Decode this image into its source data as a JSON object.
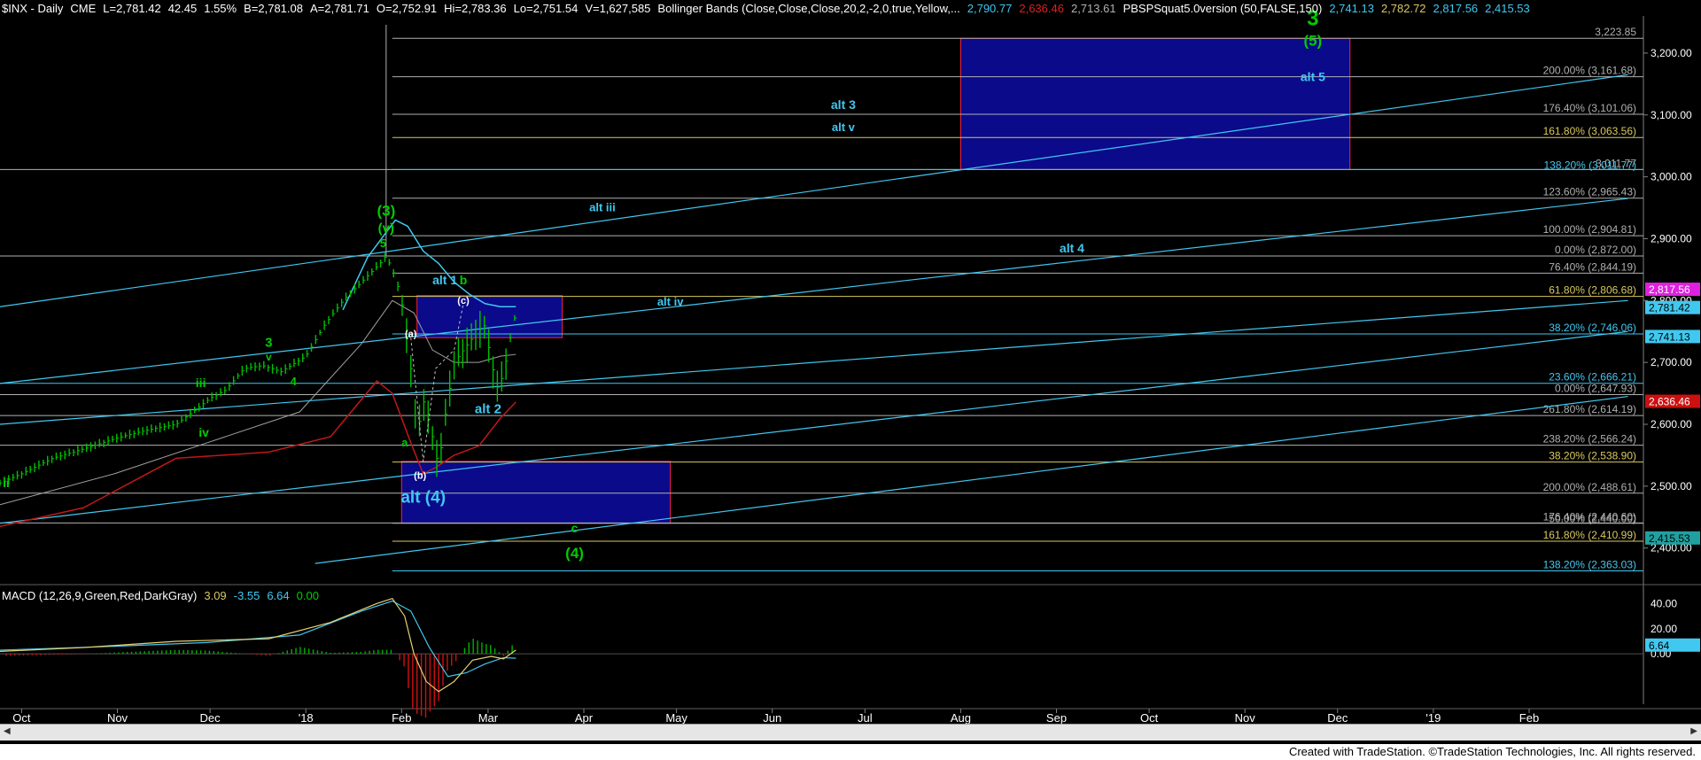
{
  "header": {
    "symbol": "$INX - Daily",
    "exchange": "CME",
    "last": "L=2,781.42",
    "chg": "42.45",
    "pct": "1.55%",
    "bid": "B=2,781.08",
    "ask": "A=2,781.71",
    "open": "O=2,752.91",
    "high": "Hi=2,783.36",
    "low": "Lo=2,751.54",
    "vol": "V=1,627,585",
    "bb": "Bollinger Bands (Close,Close,Close,20,2,-2,0,true,Yellow,...",
    "bb_v1": "2,790.77",
    "bb_v2": "2,636.46",
    "bb_v3": "2,713.61",
    "pbsp": "PBSPSquat5.0version (50,FALSE,150)",
    "pbsp_v1": "2,741.13",
    "pbsp_v2": "2,782.72",
    "pbsp_v3": "2,817.56",
    "pbsp_v4": "2,415.53"
  },
  "macd_header": {
    "label": "MACD (12,26,9,Green,Red,DarkGray)",
    "v1": "3.09",
    "v2": "-3.55",
    "v3": "6.64",
    "v4": "0.00"
  },
  "footer": "Created with TradeStation. ©TradeStation Technologies, Inc. All rights reserved.",
  "colors": {
    "bg": "#000000",
    "green_label": "#00cc00",
    "cyan_label": "#40c8f0",
    "box_fill": "#0a0a8a",
    "box_border": "#ff2040",
    "fib_gray": "#b0b0b0",
    "fib_yellow": "#d8c860",
    "fib_cyan": "#40c8f0"
  },
  "chart_data": {
    "type": "candlestick",
    "title": "$INX - Daily",
    "y_axis": {
      "ticks": [
        3200,
        3100,
        3000,
        2900,
        2800,
        2700,
        2600,
        2500,
        2400
      ],
      "tick_labels": [
        "3,200.00",
        "3,100.00",
        "3,000.00",
        "2,900.00",
        "2,800.00",
        "2,700.00",
        "2,600.00",
        "2,500.00",
        "2,400.00"
      ],
      "range": [
        2348,
        3260
      ]
    },
    "x_axis": {
      "labels": [
        "Oct",
        "Nov",
        "Dec",
        "'18",
        "Feb",
        "Mar",
        "Apr",
        "May",
        "Jun",
        "Jul",
        "Aug",
        "Sep",
        "Oct",
        "Nov",
        "Dec",
        "'19",
        "Feb"
      ],
      "label_days": [
        0,
        31,
        61,
        92,
        123,
        151,
        182,
        212,
        243,
        273,
        304,
        335,
        365,
        396,
        426,
        457,
        488
      ],
      "range_days": [
        -7,
        525
      ]
    },
    "price_path": [
      [
        -7,
        2505
      ],
      [
        0,
        2520
      ],
      [
        10,
        2545
      ],
      [
        20,
        2560
      ],
      [
        31,
        2578
      ],
      [
        40,
        2590
      ],
      [
        50,
        2600
      ],
      [
        58,
        2630
      ],
      [
        61,
        2642
      ],
      [
        66,
        2655
      ],
      [
        72,
        2690
      ],
      [
        78,
        2695
      ],
      [
        84,
        2685
      ],
      [
        92,
        2710
      ],
      [
        98,
        2760
      ],
      [
        104,
        2800
      ],
      [
        110,
        2830
      ],
      [
        116,
        2860
      ],
      [
        118,
        2872
      ],
      [
        121,
        2838
      ],
      [
        123,
        2800
      ],
      [
        126,
        2690
      ],
      [
        128,
        2581
      ],
      [
        130,
        2640
      ],
      [
        133,
        2580
      ],
      [
        135,
        2530
      ],
      [
        137,
        2610
      ],
      [
        140,
        2700
      ],
      [
        143,
        2720
      ],
      [
        146,
        2740
      ],
      [
        148,
        2752
      ],
      [
        150,
        2760
      ],
      [
        152,
        2700
      ],
      [
        154,
        2660
      ],
      [
        156,
        2680
      ],
      [
        158,
        2735
      ],
      [
        160,
        2781
      ]
    ],
    "upper_band": [
      [
        104,
        2785
      ],
      [
        112,
        2870
      ],
      [
        118,
        2910
      ],
      [
        121,
        2930
      ],
      [
        125,
        2920
      ],
      [
        130,
        2880
      ],
      [
        135,
        2860
      ],
      [
        140,
        2830
      ],
      [
        145,
        2810
      ],
      [
        150,
        2795
      ],
      [
        155,
        2790
      ],
      [
        160,
        2790
      ]
    ],
    "lower_band": [
      [
        -7,
        2435
      ],
      [
        20,
        2465
      ],
      [
        50,
        2545
      ],
      [
        80,
        2555
      ],
      [
        100,
        2580
      ],
      [
        115,
        2670
      ],
      [
        120,
        2650
      ],
      [
        126,
        2570
      ],
      [
        130,
        2520
      ],
      [
        134,
        2530
      ],
      [
        140,
        2550
      ],
      [
        148,
        2565
      ],
      [
        155,
        2610
      ],
      [
        160,
        2636
      ]
    ],
    "middle_band": [
      [
        -7,
        2470
      ],
      [
        30,
        2520
      ],
      [
        60,
        2570
      ],
      [
        90,
        2620
      ],
      [
        110,
        2730
      ],
      [
        120,
        2800
      ],
      [
        127,
        2780
      ],
      [
        133,
        2720
      ],
      [
        140,
        2700
      ],
      [
        148,
        2700
      ],
      [
        155,
        2710
      ],
      [
        160,
        2713
      ]
    ],
    "trendlines": [
      [
        [
          -7,
          2790
        ],
        [
          520,
          3165
        ]
      ],
      [
        [
          -7,
          2666
        ],
        [
          520,
          2965
        ]
      ],
      [
        [
          -7,
          2600
        ],
        [
          520,
          2800
        ]
      ],
      [
        [
          -7,
          2440
        ],
        [
          520,
          2750
        ]
      ],
      [
        [
          95,
          2375
        ],
        [
          520,
          2645
        ]
      ]
    ],
    "fib_levels": [
      {
        "price": 3223.85,
        "label": "3,223.85",
        "color": "#b0b0b0",
        "x_start": 120
      },
      {
        "price": 3161.68,
        "label": "200.00% (3,161.68)",
        "color": "#b0b0b0",
        "x_start": 120
      },
      {
        "price": 3101.06,
        "label": "176.40% (3,101.06)",
        "color": "#b0b0b0",
        "x_start": 120
      },
      {
        "price": 3063.56,
        "label": "161.80% (3,063.56)",
        "color": "#d8c860",
        "x_start": 120
      },
      {
        "price": 3011.77,
        "label": "3,011.77",
        "color": "#b0b0b0",
        "x_start": -7
      },
      {
        "price": 3011.77,
        "label": "138.20% (3,011.77)",
        "color": "#40c8f0",
        "x_start": 120,
        "label_offset": 2
      },
      {
        "price": 2965.43,
        "label": "123.60% (2,965.43)",
        "color": "#b0b0b0",
        "x_start": 120
      },
      {
        "price": 2904.81,
        "label": "100.00% (2,904.81)",
        "color": "#b0b0b0",
        "x_start": 120
      },
      {
        "price": 2872.0,
        "label": "0.00% (2,872.00)",
        "color": "#b0b0b0",
        "x_start": -7
      },
      {
        "price": 2844.19,
        "label": "76.40% (2,844.19)",
        "color": "#b0b0b0",
        "x_start": 120
      },
      {
        "price": 2806.68,
        "label": "61.80% (2,806.68)",
        "color": "#d8c860",
        "x_start": 120
      },
      {
        "price": 2746.06,
        "label": "38.20% (2,746.06)",
        "color": "#40c8f0",
        "x_start": 120
      },
      {
        "price": 2666.21,
        "label": "23.60% (2,666.21)",
        "color": "#40c8f0",
        "x_start": -7
      },
      {
        "price": 2647.93,
        "label": "0.00% (2,647.93)",
        "color": "#b0b0b0",
        "x_start": -7
      },
      {
        "price": 2614.19,
        "label": "261.80% (2,614.19)",
        "color": "#b0b0b0",
        "x_start": -7
      },
      {
        "price": 2566.24,
        "label": "238.20% (2,566.24)",
        "color": "#b0b0b0",
        "x_start": -7
      },
      {
        "price": 2538.9,
        "label": "38.20% (2,538.90)",
        "color": "#d8c860",
        "x_start": 120
      },
      {
        "price": 2488.61,
        "label": "200.00% (2,488.61)",
        "color": "#b0b0b0",
        "x_start": -7
      },
      {
        "price": 2440.6,
        "label": "176.40% (2,440.60)",
        "color": "#b0b0b0",
        "x_start": -7
      },
      {
        "price": 2440.0,
        "label": "50.00% (2,440.00)",
        "color": "#b0b0b0",
        "x_start": 120,
        "label_offset": 2
      },
      {
        "price": 2410.99,
        "label": "161.80% (2,410.99)",
        "color": "#d8c860",
        "x_start": 120
      },
      {
        "price": 2363.03,
        "label": "138.20% (2,363.03)",
        "color": "#40c8f0",
        "x_start": 120
      }
    ],
    "boxes": [
      {
        "name": "target-box-alt5",
        "x0": 304,
        "x1": 430,
        "y0": 3011.77,
        "y1": 3223.85
      },
      {
        "name": "box-alt1",
        "x0": 128,
        "x1": 175,
        "y0": 2740,
        "y1": 2808
      },
      {
        "name": "box-alt4",
        "x0": 123,
        "x1": 210,
        "y0": 2440,
        "y1": 2540
      }
    ],
    "price_tags": [
      {
        "value": "2,817.56",
        "price": 2817.56,
        "bg": "#e020e0",
        "fg": "#ffffff"
      },
      {
        "value": "2,781.42",
        "price": 2788,
        "bg": "#40c8f0",
        "fg": "#000000"
      },
      {
        "value": "2,741.13",
        "price": 2741.13,
        "bg": "#40c8f0",
        "fg": "#000000"
      },
      {
        "value": "2,636.46",
        "price": 2636.46,
        "bg": "#cc1010",
        "fg": "#ffffff"
      },
      {
        "value": "2,415.53",
        "price": 2415.53,
        "bg": "#20a0a0",
        "fg": "#000000"
      }
    ],
    "annotations": [
      {
        "text": "3",
        "day": 418,
        "price": 3245,
        "color": "green",
        "size": 24
      },
      {
        "text": "(5)",
        "day": 418,
        "price": 3212,
        "color": "green",
        "size": 17
      },
      {
        "text": "alt 5",
        "day": 418,
        "price": 3155,
        "color": "cyan",
        "size": 14
      },
      {
        "text": "alt 3",
        "day": 266,
        "price": 3110,
        "color": "cyan",
        "size": 14
      },
      {
        "text": "alt v",
        "day": 266,
        "price": 3074,
        "color": "cyan",
        "size": 13
      },
      {
        "text": "alt iii",
        "day": 188,
        "price": 2944,
        "color": "cyan",
        "size": 13
      },
      {
        "text": "alt 4",
        "day": 340,
        "price": 2878,
        "color": "cyan",
        "size": 14
      },
      {
        "text": "alt iv",
        "day": 210,
        "price": 2792,
        "color": "cyan",
        "size": 13
      },
      {
        "text": "(3)",
        "day": 118,
        "price": 2937,
        "color": "green",
        "size": 17
      },
      {
        "text": "(v)",
        "day": 118,
        "price": 2910,
        "color": "green",
        "size": 15
      },
      {
        "text": "5",
        "day": 117,
        "price": 2886,
        "color": "green",
        "size": 13
      },
      {
        "text": "alt 1",
        "day": 137,
        "price": 2826,
        "color": "cyan",
        "size": 14
      },
      {
        "text": "b",
        "day": 143,
        "price": 2826,
        "color": "green",
        "size": 14
      },
      {
        "text": "(c)",
        "day": 143,
        "price": 2795,
        "color": "white",
        "size": 11
      },
      {
        "text": "(a)",
        "day": 126,
        "price": 2741,
        "color": "white",
        "size": 11
      },
      {
        "text": "alt 2",
        "day": 151,
        "price": 2618,
        "color": "cyan",
        "size": 15
      },
      {
        "text": "a",
        "day": 124,
        "price": 2564,
        "color": "green",
        "size": 13
      },
      {
        "text": "(b)",
        "day": 129,
        "price": 2512,
        "color": "white",
        "size": 11
      },
      {
        "text": "alt (4)",
        "day": 130,
        "price": 2473,
        "color": "cyan",
        "size": 19
      },
      {
        "text": "c",
        "day": 179,
        "price": 2425,
        "color": "green",
        "size": 14
      },
      {
        "text": "(4)",
        "day": 179,
        "price": 2384,
        "color": "green",
        "size": 17
      },
      {
        "text": "3",
        "day": 80,
        "price": 2725,
        "color": "green",
        "size": 15
      },
      {
        "text": "v",
        "day": 80,
        "price": 2703,
        "color": "green",
        "size": 12
      },
      {
        "text": "iii",
        "day": 58,
        "price": 2660,
        "color": "green",
        "size": 14
      },
      {
        "text": "4",
        "day": 88,
        "price": 2663,
        "color": "green",
        "size": 13
      },
      {
        "text": "iv",
        "day": 59,
        "price": 2580,
        "color": "green",
        "size": 14
      },
      {
        "text": "ii",
        "day": -5,
        "price": 2498,
        "color": "green",
        "size": 14
      }
    ],
    "macd": {
      "y_ticks": [
        40,
        20,
        0
      ],
      "y_tick_labels": [
        "40.00",
        "20.00",
        "0.00"
      ],
      "y_range": [
        -40,
        48
      ],
      "macd_line": [
        [
          -7,
          2
        ],
        [
          20,
          5
        ],
        [
          50,
          10
        ],
        [
          80,
          12
        ],
        [
          100,
          25
        ],
        [
          115,
          40
        ],
        [
          120,
          44
        ],
        [
          124,
          30
        ],
        [
          127,
          0
        ],
        [
          131,
          -22
        ],
        [
          135,
          -30
        ],
        [
          140,
          -22
        ],
        [
          146,
          -5
        ],
        [
          152,
          -2
        ],
        [
          156,
          -4
        ],
        [
          160,
          3
        ]
      ],
      "signal_line": [
        [
          -7,
          3
        ],
        [
          30,
          6
        ],
        [
          60,
          9
        ],
        [
          90,
          15
        ],
        [
          110,
          34
        ],
        [
          120,
          42
        ],
        [
          126,
          34
        ],
        [
          132,
          5
        ],
        [
          138,
          -18
        ],
        [
          144,
          -15
        ],
        [
          150,
          -8
        ],
        [
          156,
          -3
        ],
        [
          160,
          -3.5
        ]
      ],
      "hist_range": [
        [
          2,
          160,
          3
        ]
      ],
      "value_tag": "6.64"
    }
  }
}
